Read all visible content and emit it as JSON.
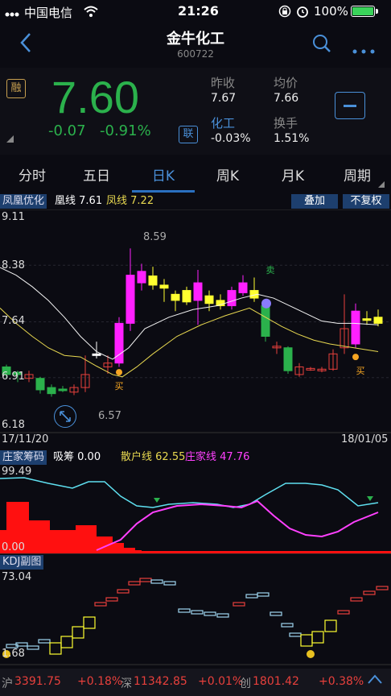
{
  "status": {
    "carrier": "中国电信",
    "time": "21:26",
    "battery": "100%"
  },
  "nav": {
    "title": "金牛化工",
    "code": "600722"
  },
  "quote": {
    "badge": "融",
    "price": "7.60",
    "change": "-0.07",
    "change_pct": "-0.91%",
    "lian": "联",
    "prev_close_label": "昨收",
    "prev_close": "7.67",
    "avg_label": "均价",
    "avg": "7.66",
    "sector_label": "化工",
    "sector": "-0.03%",
    "turnover_label": "换手",
    "turnover": "1.51%"
  },
  "tabs": [
    "分时",
    "五日",
    "日K",
    "周K",
    "月K",
    "周期"
  ],
  "main_chart": {
    "indicator": "凤凰优化",
    "huang_label": "凰线",
    "huang_value": "7.61",
    "feng_label": "凤线",
    "feng_value": "7.22",
    "overlay_btn": "叠加",
    "adjust_btn": "不复权",
    "y_max": "9.11",
    "y_2": "8.38",
    "y_3": "7.64",
    "y_4": "6.91",
    "y_min": "6.18",
    "high_mark": "8.59",
    "low_mark": "6.57",
    "date_start": "17/11/20",
    "date_end": "18/01/05",
    "buy": "买",
    "sell": "卖"
  },
  "chip_chart": {
    "indicator": "庄家筹码",
    "xichou_label": "吸筹",
    "xichou_value": "0.00",
    "sanhu_label": "散户线",
    "sanhu_value": "62.55",
    "zhuang_label": "庄家线",
    "zhuang_value": "47.76",
    "y_max": "99.49",
    "y_min": "0.00"
  },
  "kdj_chart": {
    "indicator": "KDJ副图",
    "y_max": "73.04",
    "y_min": "1.68"
  },
  "index_bar": {
    "sh_label": "沪",
    "sh_value": "3391.75",
    "sh_pct": "+0.18%",
    "sz_label": "深",
    "sz_value": "11342.85",
    "sz_pct": "+0.01%",
    "cy_label": "创",
    "cy_value": "1801.42",
    "cy_pct": "+0.38%"
  },
  "colors": {
    "up": "#e8403c",
    "down": "#2bb14c",
    "accent": "#4a90d9",
    "magenta": "#ff20ff",
    "yellow": "#ffff30"
  }
}
